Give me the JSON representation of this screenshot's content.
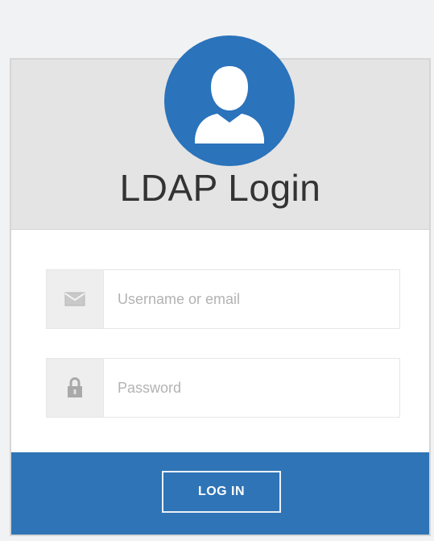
{
  "header": {
    "title": "LDAP Login",
    "avatar_icon": "user-silhouette-icon"
  },
  "form": {
    "username": {
      "icon": "envelope-icon",
      "placeholder": "Username or email",
      "value": ""
    },
    "password": {
      "icon": "lock-icon",
      "placeholder": "Password",
      "value": ""
    }
  },
  "footer": {
    "login_label": "LOG IN"
  },
  "colors": {
    "accent": "#2f74b6",
    "avatar": "#2b73bb",
    "header_bg": "#e4e4e4",
    "page_bg": "#f1f2f4"
  }
}
